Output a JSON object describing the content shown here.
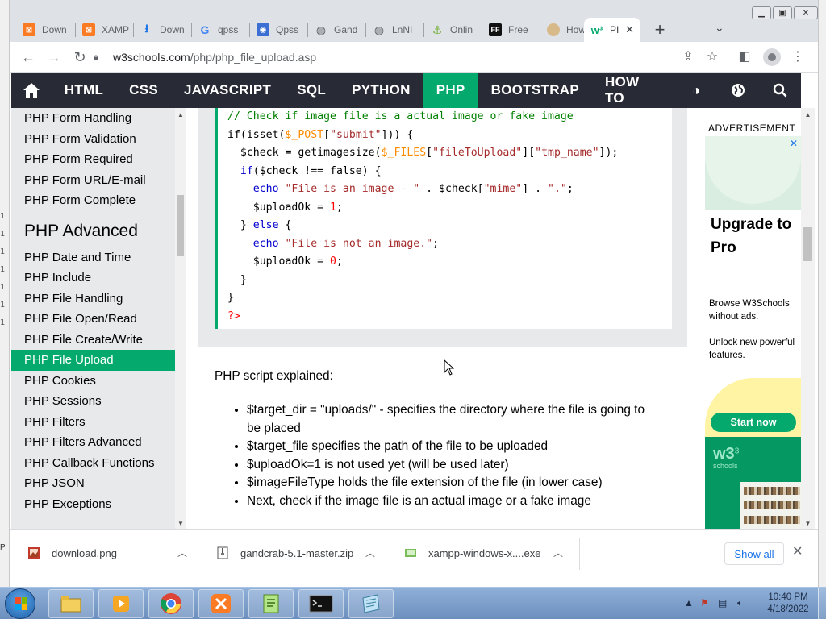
{
  "tabs": [
    {
      "label": "Down",
      "favicon": "xampp-icon",
      "color": "#fb7a24"
    },
    {
      "label": "XAMP",
      "favicon": "xampp-icon",
      "color": "#fb7a24"
    },
    {
      "label": "Down",
      "favicon": "download-icon",
      "color": "#1a73e8"
    },
    {
      "label": "qpss",
      "favicon": "google-icon",
      "color": "#4285f4"
    },
    {
      "label": "Qpss",
      "favicon": "map-icon",
      "color": "#3b6fd4"
    },
    {
      "label": "Gand",
      "favicon": "globe-icon",
      "color": "#5f6368"
    },
    {
      "label": "LnNI",
      "favicon": "globe-icon",
      "color": "#5f6368"
    },
    {
      "label": "Onlin",
      "favicon": "anchor-icon",
      "color": "#7cb342"
    },
    {
      "label": "Free",
      "favicon": "ff-icon",
      "color": "#111111"
    },
    {
      "label": "How",
      "favicon": "face-icon",
      "color": "#d8b98a"
    },
    {
      "label": "PI",
      "favicon": "w3-icon",
      "color": "#04aa6d",
      "active": true
    }
  ],
  "address": {
    "domain": "w3schools.com",
    "path": "/php/php_file_upload.asp"
  },
  "nav": {
    "items": [
      "HTML",
      "CSS",
      "JAVASCRIPT",
      "SQL",
      "PYTHON",
      "PHP",
      "BOOTSTRAP",
      "HOW TO"
    ],
    "active": "PHP"
  },
  "sidebar": {
    "links_top": [
      "PHP Form Handling",
      "PHP Form Validation",
      "PHP Form Required",
      "PHP Form URL/E-mail",
      "PHP Form Complete"
    ],
    "heading": "PHP Advanced",
    "links_bottom": [
      "PHP Date and Time",
      "PHP Include",
      "PHP File Handling",
      "PHP File Open/Read",
      "PHP File Create/Write",
      "PHP File Upload",
      "PHP Cookies",
      "PHP Sessions",
      "PHP Filters",
      "PHP Filters Advanced",
      "PHP Callback Functions",
      "PHP JSON",
      "PHP Exceptions"
    ],
    "active": "PHP File Upload"
  },
  "code": {
    "l1": "// Check if image file is a actual image or fake image",
    "l2a": "if(isset(",
    "l2b": "$_POST",
    "l2c": "[",
    "l2d": "\"submit\"",
    "l2e": "])) {",
    "l3a": "  $check = getimagesize(",
    "l3b": "$_FILES",
    "l3c": "[",
    "l3d": "\"fileToUpload\"",
    "l3e": "][",
    "l3f": "\"tmp_name\"",
    "l3g": "]);",
    "l4a": "  if",
    "l4b": "($check !== false) {",
    "l5a": "    echo ",
    "l5b": "\"File is an image - \"",
    "l5c": " . $check[",
    "l5d": "\"mime\"",
    "l5e": "] . ",
    "l5f": "\".\"",
    "l5g": ";",
    "l6a": "    $uploadOk = ",
    "l6b": "1",
    "l6c": ";",
    "l7a": "  } ",
    "l7b": "else",
    "l7c": " {",
    "l8a": "    echo ",
    "l8b": "\"File is not an image.\"",
    "l8c": ";",
    "l9a": "    $uploadOk = ",
    "l9b": "0",
    "l9c": ";",
    "l10": "  }",
    "l11": "}",
    "l12": "?>"
  },
  "explained": "PHP script explained:",
  "bullets": [
    "$target_dir = \"uploads/\" - specifies the directory where the file is going to be placed",
    "$target_file specifies the path of the file to be uploaded",
    "$uploadOk=1 is not used yet (will be used later)",
    "$imageFileType holds the file extension of the file (in lower case)",
    "Next, check if the image file is an actual image or a fake image"
  ],
  "ad": {
    "label": "ADVERTISEMENT",
    "title": "Upgrade to Pro",
    "text1": "Browse W3Schools without ads.",
    "text2": "Unlock new powerful features.",
    "button": "Start now",
    "logo": "w3",
    "logo_sup": "3",
    "logo_sub": "schools"
  },
  "downloads": [
    {
      "name": "download.png",
      "icon": "image-file-icon"
    },
    {
      "name": "gandcrab-5.1-master.zip",
      "icon": "zip-file-icon"
    },
    {
      "name": "xampp-windows-x....exe",
      "icon": "exe-file-icon"
    }
  ],
  "show_all": "Show all",
  "clock": {
    "time": "10:40 PM",
    "date": "4/18/2022"
  },
  "left_edge_chars": [
    "1",
    "1",
    "1",
    "1",
    "1",
    "1",
    "1"
  ],
  "left_bottom_char": "P",
  "colors": {
    "w3_green": "#04aa6d",
    "nav_dark": "#282a35",
    "sidebar_bg": "#e7e9eb"
  }
}
